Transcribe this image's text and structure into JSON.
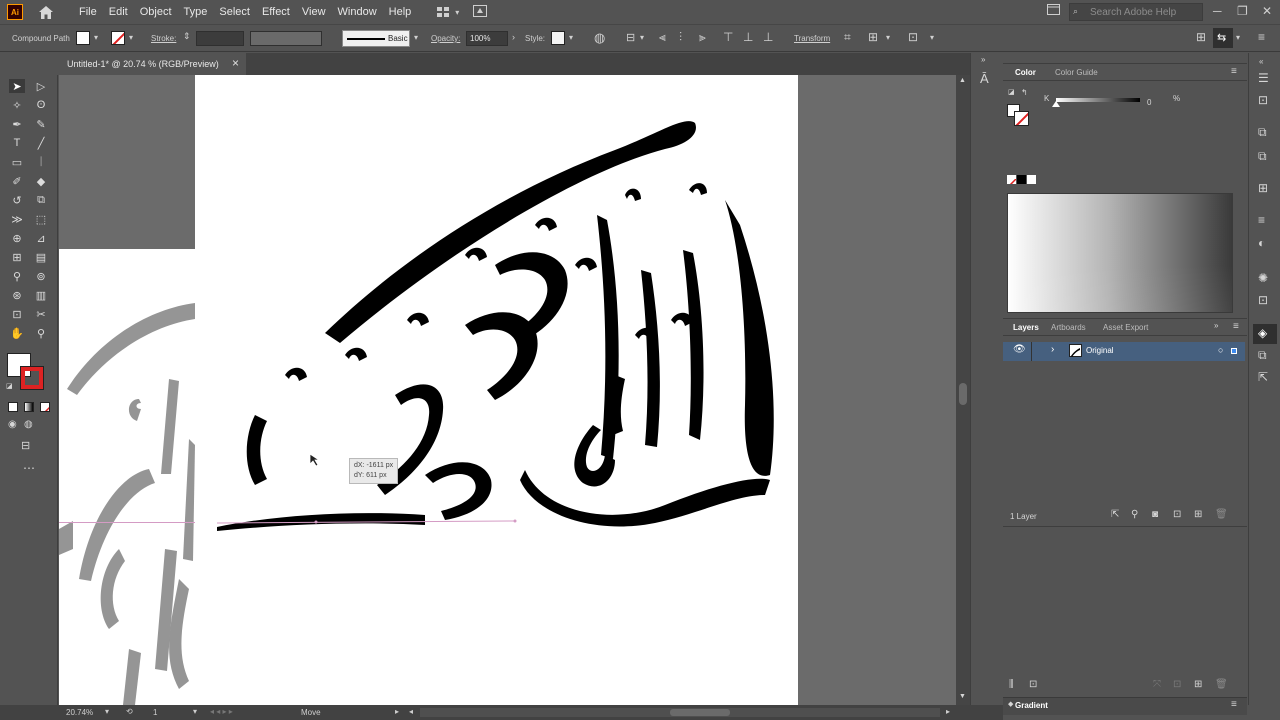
{
  "app": {
    "logo": "Ai",
    "menu": [
      "File",
      "Edit",
      "Object",
      "Type",
      "Select",
      "Effect",
      "View",
      "Window",
      "Help"
    ],
    "search_placeholder": "Search Adobe Help"
  },
  "control_bar": {
    "selection_type": "Compound Path",
    "stroke_label": "Stroke:",
    "brush_label": "Basic",
    "opacity_label": "Opacity:",
    "opacity_value": "100%",
    "style_label": "Style:",
    "transform_label": "Transform"
  },
  "document": {
    "tab_title": "Untitled-1* @ 20.74 % (RGB/Preview)",
    "close": "×"
  },
  "canvas": {
    "tooltip_dx": "dX: -1611 px",
    "tooltip_dy": "dY: 611 px"
  },
  "color_panel": {
    "tab_color": "Color",
    "tab_guide": "Color Guide",
    "channel_label": "K",
    "channel_value": "0",
    "channel_unit": "%",
    "k_level_percent": 0
  },
  "layers_panel": {
    "tabs": [
      "Layers",
      "Artboards",
      "Asset Export"
    ],
    "layer_name": "Original",
    "layer_count": "1 Layer"
  },
  "gradient_panel": {
    "title": "Gradient"
  },
  "status_bar": {
    "zoom": "20.74%",
    "artboard_number": "1",
    "tool_status": "Move"
  },
  "colors": {
    "ui_bg": "#535353",
    "selection_blue": "#46607f",
    "accent_orange": "#ff9a00"
  }
}
